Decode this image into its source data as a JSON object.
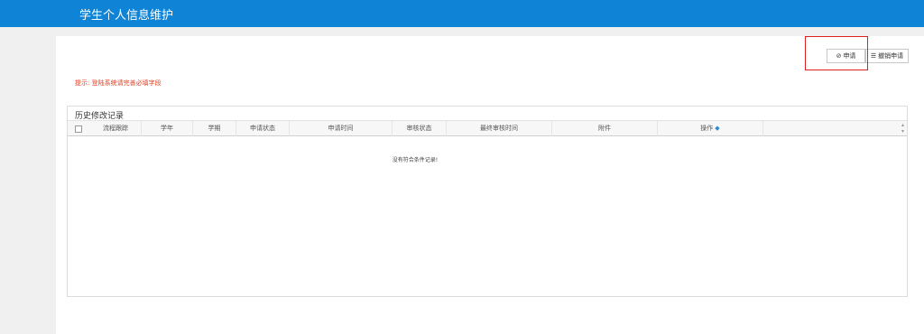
{
  "header": {
    "title": "学生个人信息维护"
  },
  "toolbar": {
    "apply_label": "申请",
    "revoke_label": "撤销申请"
  },
  "hint": {
    "text": "提示: 登陆系统请完善必填字段"
  },
  "history": {
    "title": "历史修改记录",
    "columns": [
      "流程跟踪",
      "学年",
      "学期",
      "申请状态",
      "申请时间",
      "审核状态",
      "最终审核时间",
      "附件",
      "操作"
    ],
    "empty_message": "没有符合条件记录!"
  }
}
